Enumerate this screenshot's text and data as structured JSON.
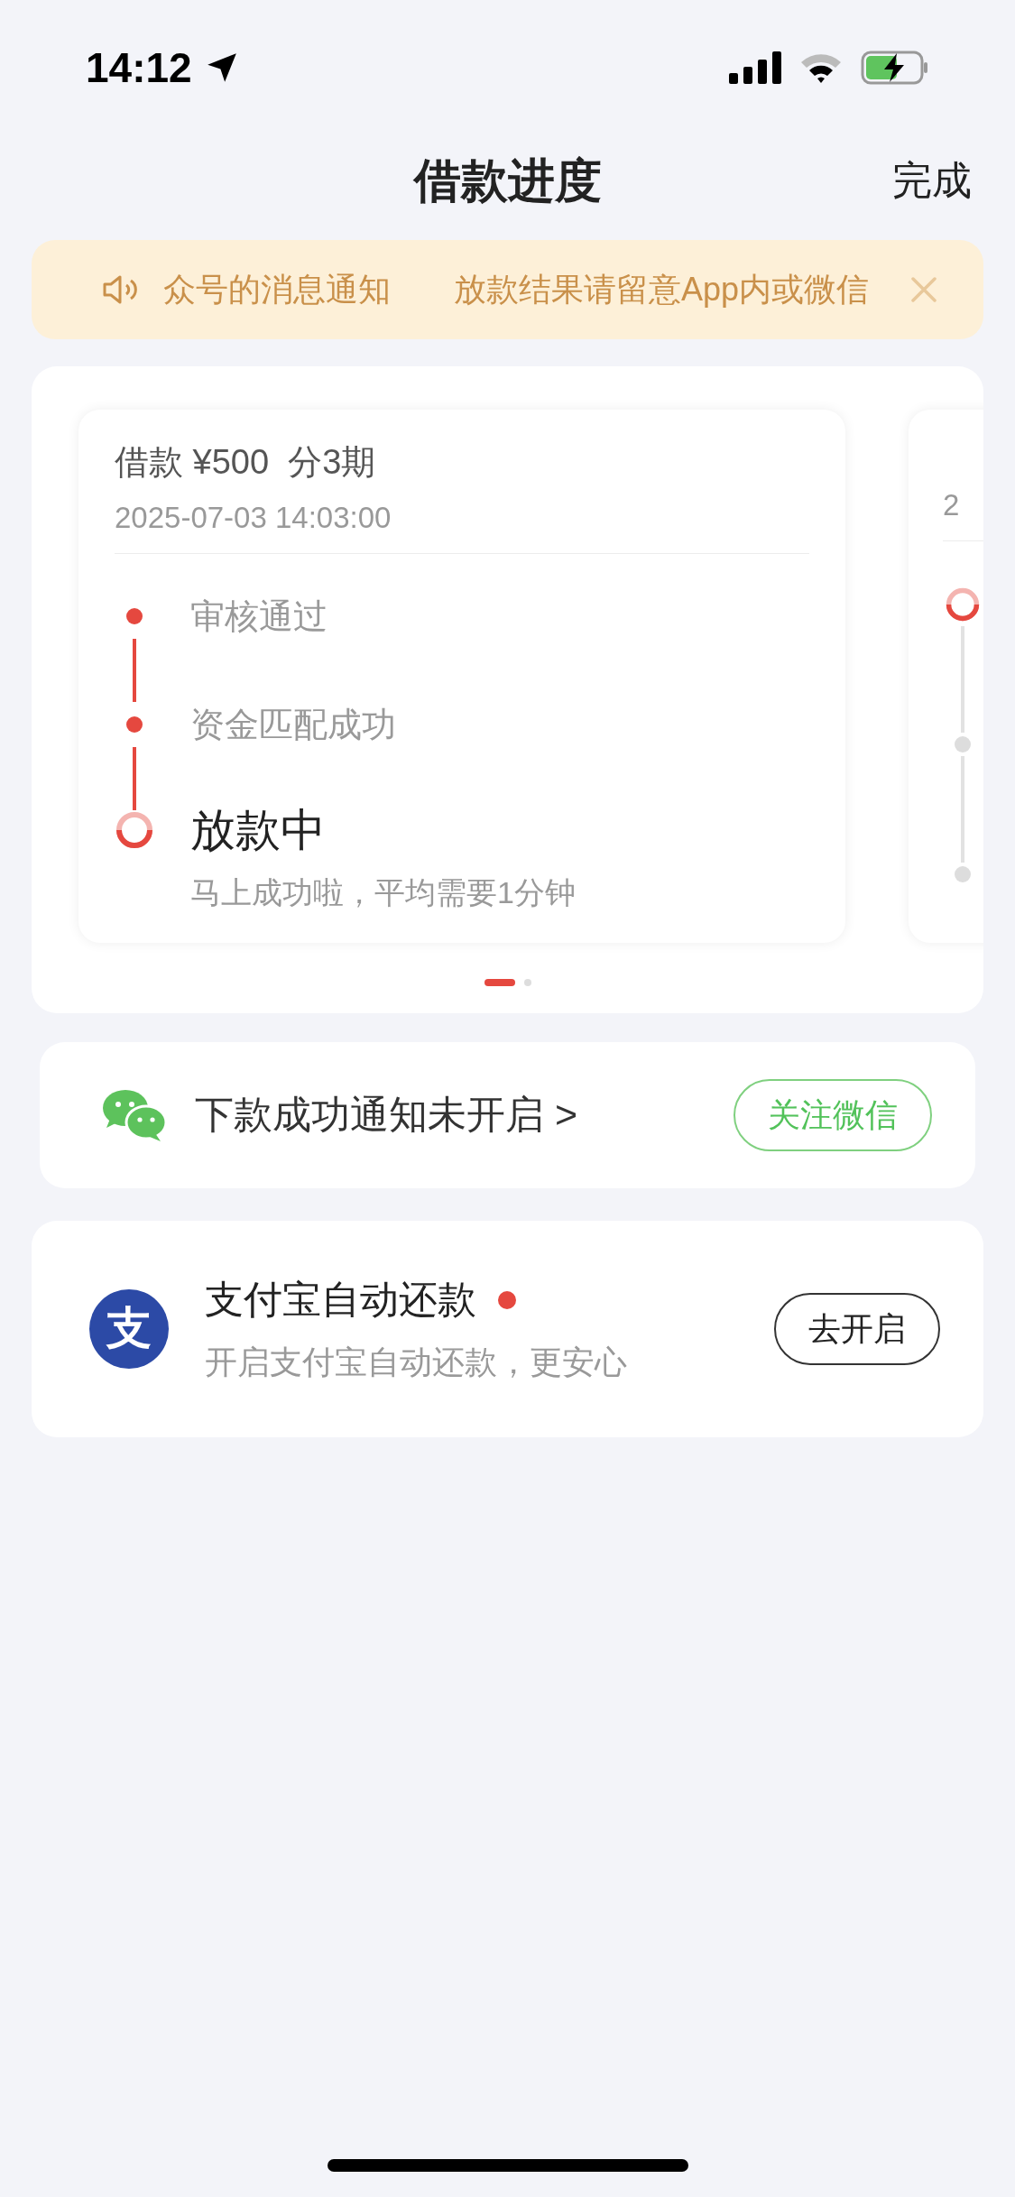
{
  "status_bar": {
    "time": "14:12"
  },
  "header": {
    "title": "借款进度",
    "action": "完成"
  },
  "notice": {
    "texts": [
      "众号的消息通知",
      "放款结果请留意App内或微信"
    ]
  },
  "loans": [
    {
      "title": "借款 ¥500  分3期",
      "date": "2025-07-03 14:03:00",
      "steps": [
        {
          "label": "审核通过",
          "kind": "done"
        },
        {
          "label": "资金匹配成功",
          "kind": "done"
        },
        {
          "label": "放款中",
          "kind": "current",
          "note": "马上成功啦，平均需要1分钟"
        }
      ]
    },
    {
      "date": "2",
      "steps": [
        {
          "kind": "current"
        },
        {
          "kind": "pending"
        },
        {
          "kind": "pending"
        }
      ]
    }
  ],
  "pager": [
    {
      "selected": true
    },
    {
      "selected": false
    }
  ],
  "wechat": {
    "text": "下款成功通知未开启 >",
    "button": "关注微信"
  },
  "alipay": {
    "logo": "支",
    "title": "支付宝自动还款",
    "unread": true,
    "subtitle": "开启支付宝自动还款，更安心",
    "button": "去开启"
  }
}
